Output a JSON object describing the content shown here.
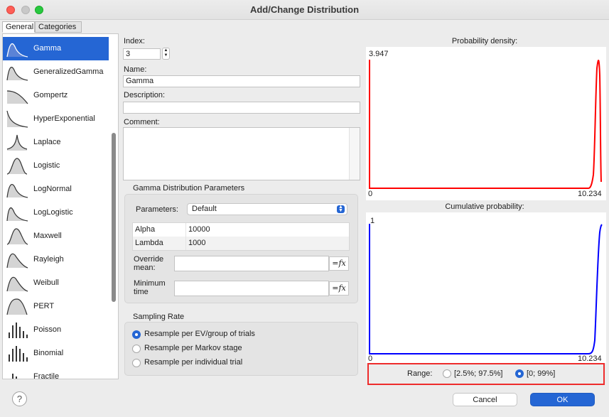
{
  "window": {
    "title": "Add/Change Distribution"
  },
  "tabs": [
    {
      "label": "General"
    },
    {
      "label": "Categories"
    }
  ],
  "distributions": [
    {
      "label": "Gamma",
      "icon": "gamma-curve-icon"
    },
    {
      "label": "GeneralizedGamma",
      "icon": "generalized-gamma-curve-icon"
    },
    {
      "label": "Gompertz",
      "icon": "gompertz-curve-icon"
    },
    {
      "label": "HyperExponential",
      "icon": "hyperexponential-curve-icon"
    },
    {
      "label": "Laplace",
      "icon": "laplace-curve-icon"
    },
    {
      "label": "Logistic",
      "icon": "logistic-curve-icon"
    },
    {
      "label": "LogNormal",
      "icon": "lognormal-curve-icon"
    },
    {
      "label": "LogLogistic",
      "icon": "loglogistic-curve-icon"
    },
    {
      "label": "Maxwell",
      "icon": "maxwell-curve-icon"
    },
    {
      "label": "Rayleigh",
      "icon": "rayleigh-curve-icon"
    },
    {
      "label": "Weibull",
      "icon": "weibull-curve-icon"
    },
    {
      "label": "PERT",
      "icon": "pert-curve-icon"
    },
    {
      "label": "Poisson",
      "icon": "poisson-bars-icon"
    },
    {
      "label": "Binomial",
      "icon": "binomial-bars-icon"
    },
    {
      "label": "Fractile",
      "icon": "fractile-bars-icon"
    }
  ],
  "form": {
    "index_label": "Index:",
    "index_value": "3",
    "name_label": "Name:",
    "name_value": "Gamma",
    "description_label": "Description:",
    "description_value": "",
    "comment_label": "Comment:",
    "comment_value": ""
  },
  "params": {
    "group_title": "Gamma Distribution Parameters",
    "parameters_label": "Parameters:",
    "parameters_value": "Default",
    "rows": [
      {
        "name": "Alpha",
        "value": "10000"
      },
      {
        "name": "Lambda",
        "value": "1000"
      }
    ],
    "override_mean_label_1": "Override",
    "override_mean_label_2": "mean:",
    "minimum_time_label_1": "Minimum",
    "minimum_time_label_2": "time",
    "fx_label": "=fx"
  },
  "sampling": {
    "group_title": "Sampling Rate",
    "options": [
      {
        "label": "Resample per EV/group of trials",
        "selected": true
      },
      {
        "label": "Resample per Markov stage",
        "selected": false
      },
      {
        "label": "Resample per individual trial",
        "selected": false
      }
    ]
  },
  "density_chart": {
    "title": "Probability density:",
    "y_max_label": "3.947",
    "x_min_label": "0",
    "x_max_label": "10.234",
    "color": "#ff0000"
  },
  "cumulative_chart": {
    "title": "Cumulative probability:",
    "y_max_label": "1",
    "x_min_label": "0",
    "x_max_label": "10.234",
    "color": "#0000ff"
  },
  "range": {
    "label": "Range:",
    "options": [
      {
        "label": "[2.5%; 97.5%]",
        "selected": false
      },
      {
        "label": "[0; 99%]",
        "selected": true
      }
    ]
  },
  "buttons": {
    "cancel": "Cancel",
    "ok": "OK",
    "help": "?"
  },
  "colors": {
    "accent": "#2566d4",
    "highlight_border": "#ee2c2c"
  }
}
